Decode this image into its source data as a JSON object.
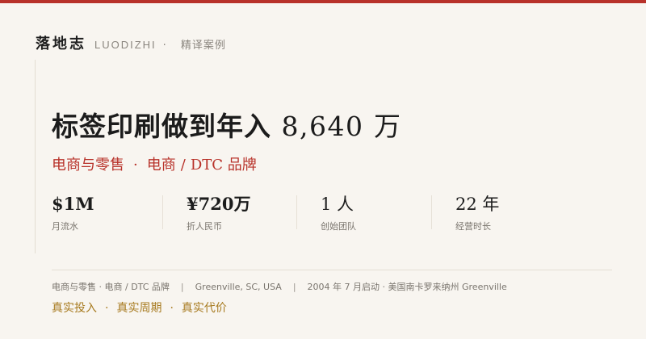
{
  "colors": {
    "accent": "#b8322a",
    "gold": "#a77a1f",
    "background": "#f8f5f0"
  },
  "brand": {
    "name_cn": "落地志",
    "name_en": "LUODIZHI",
    "dot": "·",
    "section": "精译案例"
  },
  "headline": {
    "text": "标签印刷做到年入",
    "number": "8,640",
    "unit": "万"
  },
  "subline": {
    "category": "电商与零售",
    "dot": "·",
    "sub": "电商",
    "slash": "/",
    "sub2": "DTC 品牌"
  },
  "stats": [
    {
      "value": "$1M",
      "label": "月流水"
    },
    {
      "value": "¥720万",
      "label": "折人民币"
    },
    {
      "value": "1 人",
      "label": "创始团队"
    },
    {
      "value": "22 年",
      "label": "经营时长"
    }
  ],
  "meta": {
    "category": "电商与零售 · 电商 / DTC 品牌",
    "sep": "|",
    "location": "Greenville, SC, USA",
    "started": "2004 年 7 月启动 · 美国南卡罗来纳州 Greenville"
  },
  "tags": [
    "真实投入",
    "真实周期",
    "真实代价"
  ],
  "tag_dot": "·"
}
